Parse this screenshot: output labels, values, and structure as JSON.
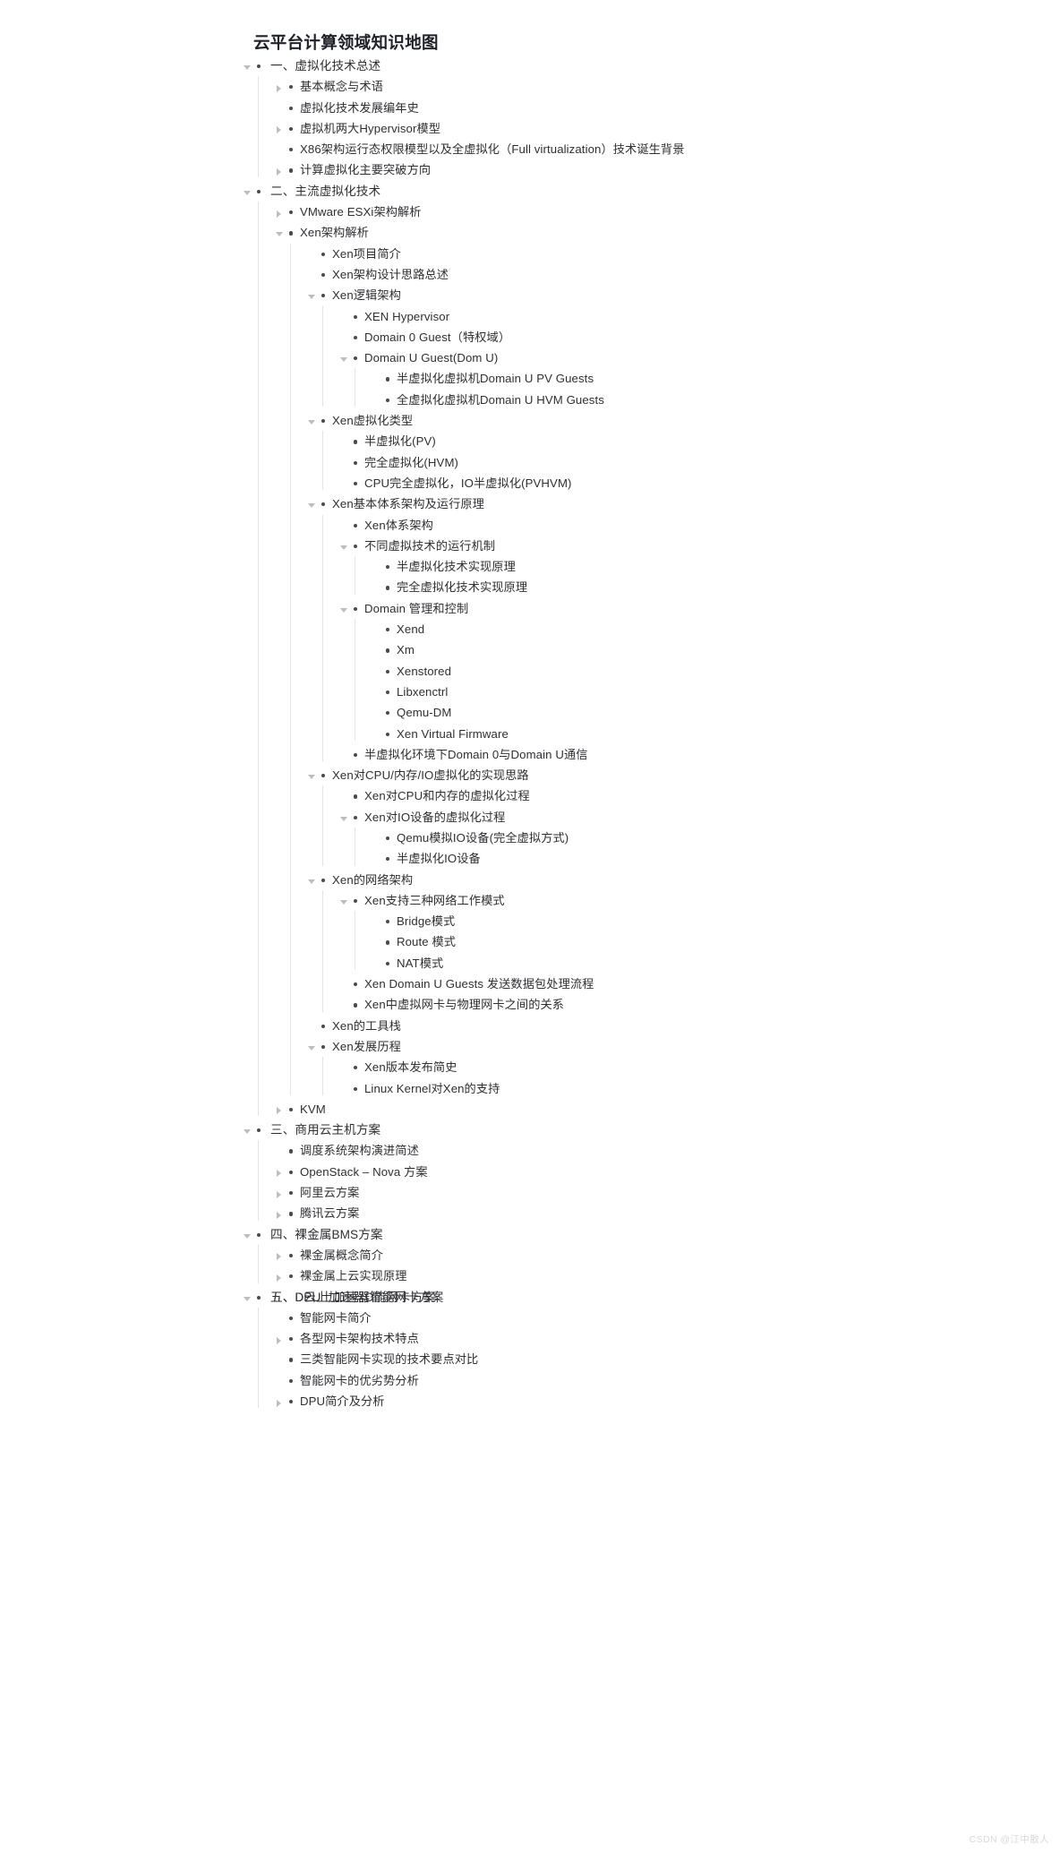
{
  "page": {
    "title": "云平台计算领域知识地图",
    "watermark": "CSDN @江中散人"
  },
  "icons": {
    "caret_expanded": "chevron-down-icon",
    "caret_collapsed": "chevron-right-icon",
    "bullet": "bullet-dot-icon"
  },
  "colors": {
    "text": "#2f3034",
    "title": "#20222a",
    "guide_line": "#e3e3e6",
    "caret": "#bcbcc2",
    "bullet": "#494a50",
    "watermark": "#d8d8dc",
    "background": "#ffffff"
  },
  "outline": [
    {
      "label": "一、虚拟化技术总述",
      "state": "expanded",
      "children": [
        {
          "label": "基本概念与术语",
          "state": "collapsed"
        },
        {
          "label": "虚拟化技术发展编年史",
          "state": "leaf"
        },
        {
          "label": "虚拟机两大Hypervisor模型",
          "state": "collapsed"
        },
        {
          "label": "X86架构运行态权限模型以及全虚拟化（Full virtualization）技术诞生背景",
          "state": "leaf"
        },
        {
          "label": "计算虚拟化主要突破方向",
          "state": "collapsed"
        }
      ]
    },
    {
      "label": "二、主流虚拟化技术",
      "state": "expanded",
      "children": [
        {
          "label": "VMware ESXi架构解析",
          "state": "collapsed"
        },
        {
          "label": "Xen架构解析",
          "state": "expanded",
          "children": [
            {
              "label": "Xen项目简介",
              "state": "leaf"
            },
            {
              "label": "Xen架构设计思路总述",
              "state": "leaf"
            },
            {
              "label": "Xen逻辑架构",
              "state": "expanded",
              "children": [
                {
                  "label": "XEN Hypervisor",
                  "state": "leaf"
                },
                {
                  "label": "Domain 0 Guest（特权域）",
                  "state": "leaf"
                },
                {
                  "label": "Domain U Guest(Dom U)",
                  "state": "expanded",
                  "children": [
                    {
                      "label": "半虚拟化虚拟机Domain U PV Guests",
                      "state": "leaf"
                    },
                    {
                      "label": "全虚拟化虚拟机Domain U HVM Guests",
                      "state": "leaf"
                    }
                  ]
                }
              ]
            },
            {
              "label": "Xen虚拟化类型",
              "state": "expanded",
              "children": [
                {
                  "label": "半虚拟化(PV)",
                  "state": "leaf"
                },
                {
                  "label": "完全虚拟化(HVM)",
                  "state": "leaf"
                },
                {
                  "label": "CPU完全虚拟化，IO半虚拟化(PVHVM)",
                  "state": "leaf"
                }
              ]
            },
            {
              "label": "Xen基本体系架构及运行原理",
              "state": "expanded",
              "children": [
                {
                  "label": "Xen体系架构",
                  "state": "leaf"
                },
                {
                  "label": "不同虚拟技术的运行机制",
                  "state": "expanded",
                  "children": [
                    {
                      "label": "半虚拟化技术实现原理",
                      "state": "leaf"
                    },
                    {
                      "label": "完全虚拟化技术实现原理",
                      "state": "leaf"
                    }
                  ]
                },
                {
                  "label": "Domain 管理和控制",
                  "state": "expanded",
                  "children": [
                    {
                      "label": "Xend",
                      "state": "leaf"
                    },
                    {
                      "label": "Xm",
                      "state": "leaf"
                    },
                    {
                      "label": "Xenstored",
                      "state": "leaf"
                    },
                    {
                      "label": "Libxenctrl",
                      "state": "leaf"
                    },
                    {
                      "label": "Qemu-DM",
                      "state": "leaf"
                    },
                    {
                      "label": "Xen Virtual Firmware",
                      "state": "leaf"
                    }
                  ]
                },
                {
                  "label": "半虚拟化环境下Domain 0与Domain U通信",
                  "state": "leaf"
                }
              ]
            },
            {
              "label": "Xen对CPU/内存/IO虚拟化的实现思路",
              "state": "expanded",
              "children": [
                {
                  "label": "Xen对CPU和内存的虚拟化过程",
                  "state": "leaf"
                },
                {
                  "label": "Xen对IO设备的虚拟化过程",
                  "state": "expanded",
                  "children": [
                    {
                      "label": "Qemu模拟IO设备(完全虚拟方式)",
                      "state": "leaf"
                    },
                    {
                      "label": "半虚拟化IO设备",
                      "state": "leaf"
                    }
                  ]
                }
              ]
            },
            {
              "label": "Xen的网络架构",
              "state": "expanded",
              "children": [
                {
                  "label": "Xen支持三种网络工作模式",
                  "state": "expanded",
                  "children": [
                    {
                      "label": "Bridge模式",
                      "state": "leaf"
                    },
                    {
                      "label": "Route 模式",
                      "state": "leaf"
                    },
                    {
                      "label": "NAT模式",
                      "state": "leaf"
                    }
                  ]
                },
                {
                  "label": "Xen Domain U Guests 发送数据包处理流程",
                  "state": "leaf"
                },
                {
                  "label": "Xen中虚拟网卡与物理网卡之间的关系",
                  "state": "leaf"
                }
              ]
            },
            {
              "label": "Xen的工具栈",
              "state": "leaf"
            },
            {
              "label": "Xen发展历程",
              "state": "expanded",
              "children": [
                {
                  "label": "Xen版本发布简史",
                  "state": "leaf"
                },
                {
                  "label": "Linux Kernel对Xen的支持",
                  "state": "leaf"
                }
              ]
            }
          ]
        },
        {
          "label": "KVM",
          "state": "collapsed"
        }
      ]
    },
    {
      "label": "三、商用云主机方案",
      "state": "expanded",
      "children": [
        {
          "label": "调度系统架构演进简述",
          "state": "leaf"
        },
        {
          "label": "OpenStack – Nova 方案",
          "state": "collapsed"
        },
        {
          "label": "阿里云方案",
          "state": "collapsed"
        },
        {
          "label": "腾讯云方案",
          "state": "collapsed"
        }
      ]
    },
    {
      "label": "四、裸金属BMS方案",
      "state": "expanded",
      "children": [
        {
          "label": "裸金属概念简介",
          "state": "collapsed"
        },
        {
          "label": "裸金属上云实现原理",
          "state": "collapsed"
        }
      ]
    },
    {
      "label": "五、DPU上加速器智能网卡方案",
      "label_overlay": "五、D云上加速器D能网卡方案",
      "state": "expanded",
      "children": [
        {
          "label": "智能网卡简介",
          "state": "leaf"
        },
        {
          "label": "各型网卡架构技术特点",
          "state": "collapsed"
        },
        {
          "label": "三类智能网卡实现的技术要点对比",
          "state": "leaf"
        },
        {
          "label": "智能网卡的优劣势分析",
          "state": "leaf"
        },
        {
          "label": "DPU简介及分析",
          "state": "collapsed"
        }
      ]
    }
  ]
}
